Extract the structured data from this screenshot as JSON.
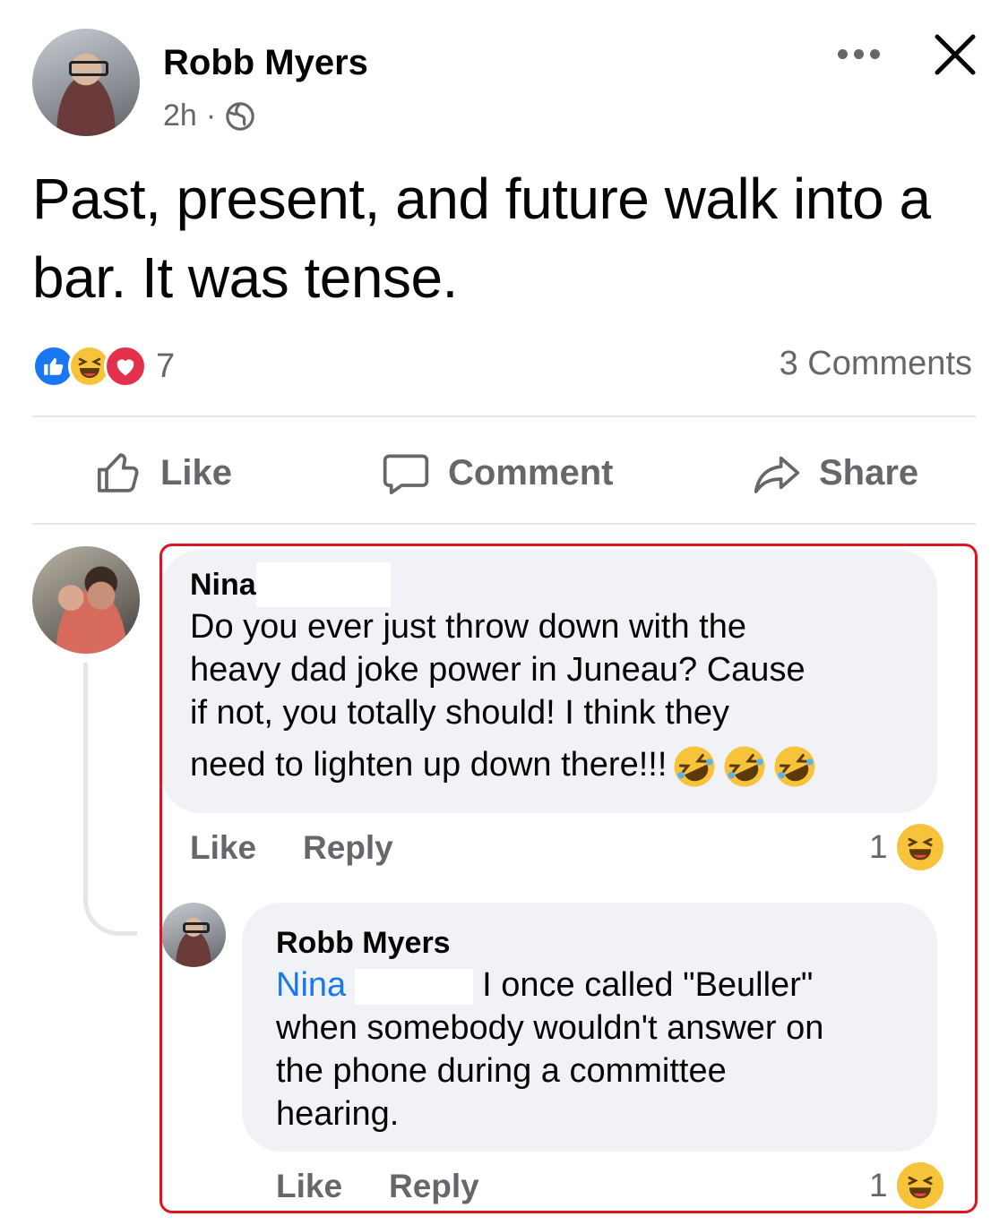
{
  "post": {
    "author": "Robb Myers",
    "time": "2h",
    "separator": "·",
    "audience_icon": "globe-icon",
    "text": "Past, present, and future walk into a bar. It was tense.",
    "reactions": [
      "like-reaction-icon",
      "haha-reaction-icon",
      "love-reaction-icon"
    ],
    "reaction_count": "7",
    "comments_count": "3 Comments"
  },
  "actions": {
    "like": "Like",
    "comment": "Comment",
    "share": "Share"
  },
  "comments": [
    {
      "author": "Nina",
      "text_lines": [
        "Do you ever just throw down with the",
        "heavy dad joke power in Juneau?  Cause",
        "if not, you totally should!  I think they",
        "need to lighten up down there!!!"
      ],
      "emojis": [
        "rolling-laughing-emoji",
        "rolling-laughing-emoji",
        "rolling-laughing-emoji"
      ],
      "like": "Like",
      "reply": "Reply",
      "reaction_count": "1"
    },
    {
      "author": "Robb Myers",
      "mention": "Nina",
      "text_first": "I once called \"Beuller\"",
      "text_lines": [
        "when somebody wouldn't answer on",
        "the phone during a committee",
        "hearing."
      ],
      "like": "Like",
      "reply": "Reply",
      "reaction_count": "1"
    }
  ],
  "colors": {
    "accent": "#1877f2",
    "highlight_border": "#e0141e",
    "muted_text": "#65676b",
    "bubble_bg": "#f0f2f5"
  }
}
